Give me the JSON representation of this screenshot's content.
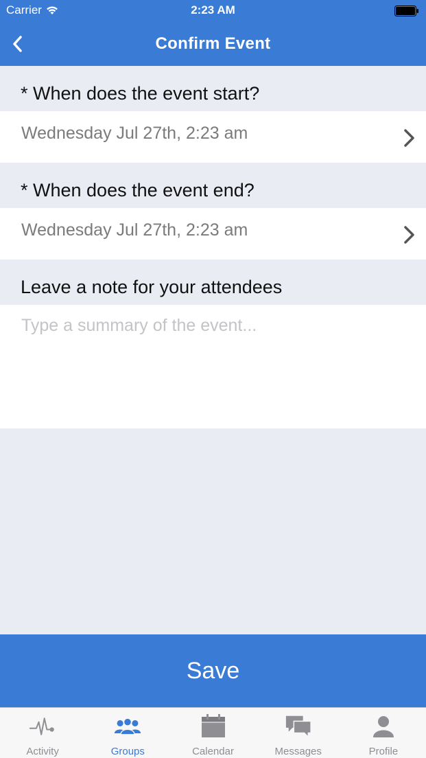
{
  "status_bar": {
    "carrier": "Carrier",
    "time": "2:23 AM"
  },
  "nav": {
    "title": "Confirm Event"
  },
  "start": {
    "label": "* When does the event start?",
    "value": "Wednesday Jul 27th, 2:23 am"
  },
  "end": {
    "label": "* When does the event end?",
    "value": "Wednesday Jul 27th, 2:23 am"
  },
  "note": {
    "label": "Leave a note for your attendees",
    "placeholder": "Type a summary of the event..."
  },
  "save_label": "Save",
  "tabs": [
    {
      "label": "Activity",
      "icon": "activity-icon",
      "active": false
    },
    {
      "label": "Groups",
      "icon": "groups-icon",
      "active": true
    },
    {
      "label": "Calendar",
      "icon": "calendar-icon",
      "active": false
    },
    {
      "label": "Messages",
      "icon": "messages-icon",
      "active": false
    },
    {
      "label": "Profile",
      "icon": "profile-icon",
      "active": false
    }
  ],
  "colors": {
    "accent": "#3a7bd5",
    "background": "#e9ecf3",
    "inactive_tab": "#8e8e93"
  }
}
